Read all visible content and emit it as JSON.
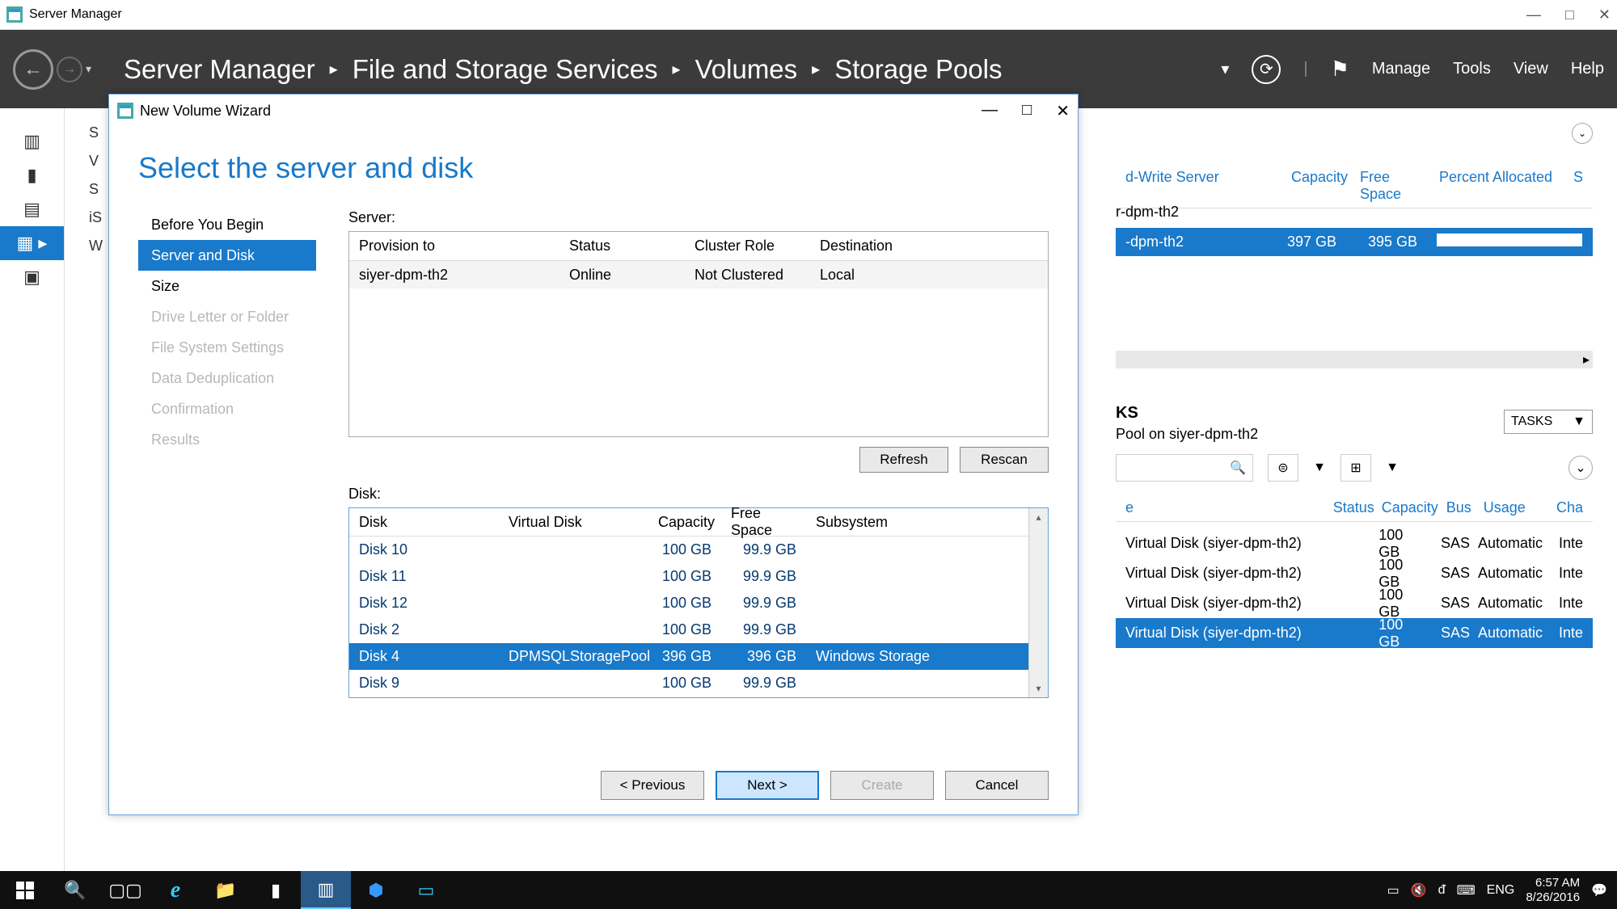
{
  "window": {
    "title": "Server Manager"
  },
  "breadcrumb": [
    "Server Manager",
    "File and Storage Services",
    "Volumes",
    "Storage Pools"
  ],
  "menu": {
    "manage": "Manage",
    "tools": "Tools",
    "view": "View",
    "help": "Help"
  },
  "left_labels": [
    "S",
    "V",
    "S",
    "iS",
    "W"
  ],
  "bg": {
    "headers": {
      "rw": "d-Write Server",
      "capacity": "Capacity",
      "free": "Free Space",
      "percent": "Percent Allocated",
      "s": "S"
    },
    "row_unselected_text": "r-dpm-th2",
    "sel_row": {
      "name": "-dpm-th2",
      "capacity": "397 GB",
      "free": "395 GB"
    },
    "ks": "KS",
    "ks_sub": "Pool on siyer-dpm-th2",
    "tasks": "TASKS",
    "pd_head": {
      "e": "e",
      "status": "Status",
      "capacity": "Capacity",
      "bus": "Bus",
      "usage": "Usage",
      "cha": "Cha"
    },
    "pd_rows": [
      {
        "name": "Virtual Disk (siyer-dpm-th2)",
        "capacity": "100 GB",
        "bus": "SAS",
        "usage": "Automatic",
        "ch": "Inte"
      },
      {
        "name": "Virtual Disk (siyer-dpm-th2)",
        "capacity": "100 GB",
        "bus": "SAS",
        "usage": "Automatic",
        "ch": "Inte"
      },
      {
        "name": "Virtual Disk (siyer-dpm-th2)",
        "capacity": "100 GB",
        "bus": "SAS",
        "usage": "Automatic",
        "ch": "Inte"
      },
      {
        "name": "Virtual Disk (siyer-dpm-th2)",
        "capacity": "100 GB",
        "bus": "SAS",
        "usage": "Automatic",
        "ch": "Inte",
        "selected": true
      }
    ]
  },
  "wizard": {
    "title": "New Volume Wizard",
    "heading": "Select the server and disk",
    "nav": [
      {
        "label": "Before You Begin",
        "state": "normal"
      },
      {
        "label": "Server and Disk",
        "state": "active"
      },
      {
        "label": "Size",
        "state": "normal"
      },
      {
        "label": "Drive Letter or Folder",
        "state": "disabled"
      },
      {
        "label": "File System Settings",
        "state": "disabled"
      },
      {
        "label": "Data Deduplication",
        "state": "disabled"
      },
      {
        "label": "Confirmation",
        "state": "disabled"
      },
      {
        "label": "Results",
        "state": "disabled"
      }
    ],
    "server_label": "Server:",
    "server_headers": {
      "provision": "Provision to",
      "status": "Status",
      "cluster": "Cluster Role",
      "dest": "Destination"
    },
    "server_row": {
      "provision": "siyer-dpm-th2",
      "status": "Online",
      "cluster": "Not Clustered",
      "dest": "Local"
    },
    "refresh": "Refresh",
    "rescan": "Rescan",
    "disk_label": "Disk:",
    "disk_headers": {
      "disk": "Disk",
      "vdisk": "Virtual Disk",
      "capacity": "Capacity",
      "free": "Free Space",
      "sub": "Subsystem"
    },
    "disk_rows": [
      {
        "disk": "Disk 10",
        "vdisk": "",
        "capacity": "100 GB",
        "free": "99.9 GB",
        "sub": ""
      },
      {
        "disk": "Disk 11",
        "vdisk": "",
        "capacity": "100 GB",
        "free": "99.9 GB",
        "sub": ""
      },
      {
        "disk": "Disk 12",
        "vdisk": "",
        "capacity": "100 GB",
        "free": "99.9 GB",
        "sub": ""
      },
      {
        "disk": "Disk 2",
        "vdisk": "",
        "capacity": "100 GB",
        "free": "99.9 GB",
        "sub": ""
      },
      {
        "disk": "Disk 4",
        "vdisk": "DPMSQLStoragePool",
        "capacity": "396 GB",
        "free": "396 GB",
        "sub": "Windows Storage",
        "selected": true
      },
      {
        "disk": "Disk 9",
        "vdisk": "",
        "capacity": "100 GB",
        "free": "99.9 GB",
        "sub": ""
      }
    ],
    "footer": {
      "prev": "< Previous",
      "next": "Next >",
      "create": "Create",
      "cancel": "Cancel"
    }
  },
  "taskbar": {
    "lang": "ENG",
    "time": "6:57 AM",
    "date": "8/26/2016"
  }
}
